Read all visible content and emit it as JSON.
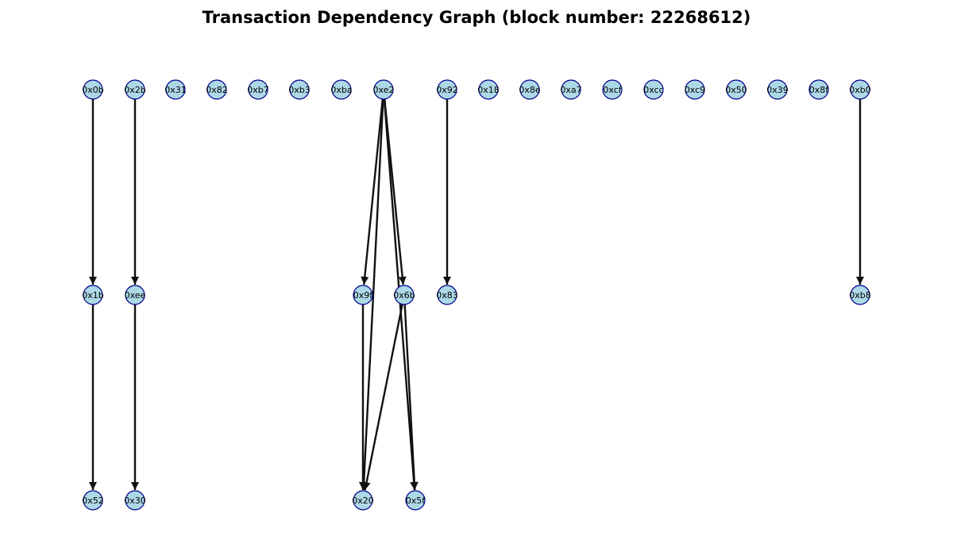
{
  "title": "Transaction Dependency Graph (block number: 22268612)",
  "colors": {
    "node_fill": "#add8e6",
    "node_stroke": "#00008b",
    "edge": "#111111"
  },
  "nodes": [
    {
      "id": "0x0b",
      "level": 0
    },
    {
      "id": "0x2b",
      "level": 0
    },
    {
      "id": "0x31",
      "level": 0
    },
    {
      "id": "0x82",
      "level": 0
    },
    {
      "id": "0xb7",
      "level": 0
    },
    {
      "id": "0xb3",
      "level": 0
    },
    {
      "id": "0xba",
      "level": 0
    },
    {
      "id": "0xe2",
      "level": 0
    },
    {
      "id": "0x92",
      "level": 0
    },
    {
      "id": "0x18",
      "level": 0
    },
    {
      "id": "0x8e",
      "level": 0
    },
    {
      "id": "0xa7",
      "level": 0
    },
    {
      "id": "0xcf",
      "level": 0
    },
    {
      "id": "0xcc",
      "level": 0
    },
    {
      "id": "0xc9",
      "level": 0
    },
    {
      "id": "0x50",
      "level": 0
    },
    {
      "id": "0x39",
      "level": 0
    },
    {
      "id": "0x8f",
      "level": 0
    },
    {
      "id": "0xb0",
      "level": 0
    },
    {
      "id": "0x1b",
      "level": 1
    },
    {
      "id": "0xee",
      "level": 1
    },
    {
      "id": "0x9f",
      "level": 1
    },
    {
      "id": "0x6b",
      "level": 1
    },
    {
      "id": "0x83",
      "level": 1
    },
    {
      "id": "0xb8",
      "level": 1
    },
    {
      "id": "0x52",
      "level": 2
    },
    {
      "id": "0x30",
      "level": 2
    },
    {
      "id": "0x20",
      "level": 2
    },
    {
      "id": "0x5f",
      "level": 2
    }
  ],
  "edges": [
    {
      "from": "0x0b",
      "to": "0x1b"
    },
    {
      "from": "0x2b",
      "to": "0xee"
    },
    {
      "from": "0xe2",
      "to": "0x9f"
    },
    {
      "from": "0xe2",
      "to": "0x6b"
    },
    {
      "from": "0xe2",
      "to": "0x20"
    },
    {
      "from": "0xe2",
      "to": "0x5f"
    },
    {
      "from": "0x92",
      "to": "0x83"
    },
    {
      "from": "0xb0",
      "to": "0xb8"
    },
    {
      "from": "0x1b",
      "to": "0x52"
    },
    {
      "from": "0xee",
      "to": "0x30"
    },
    {
      "from": "0x9f",
      "to": "0x20"
    },
    {
      "from": "0x6b",
      "to": "0x20"
    },
    {
      "from": "0x6b",
      "to": "0x5f"
    }
  ]
}
